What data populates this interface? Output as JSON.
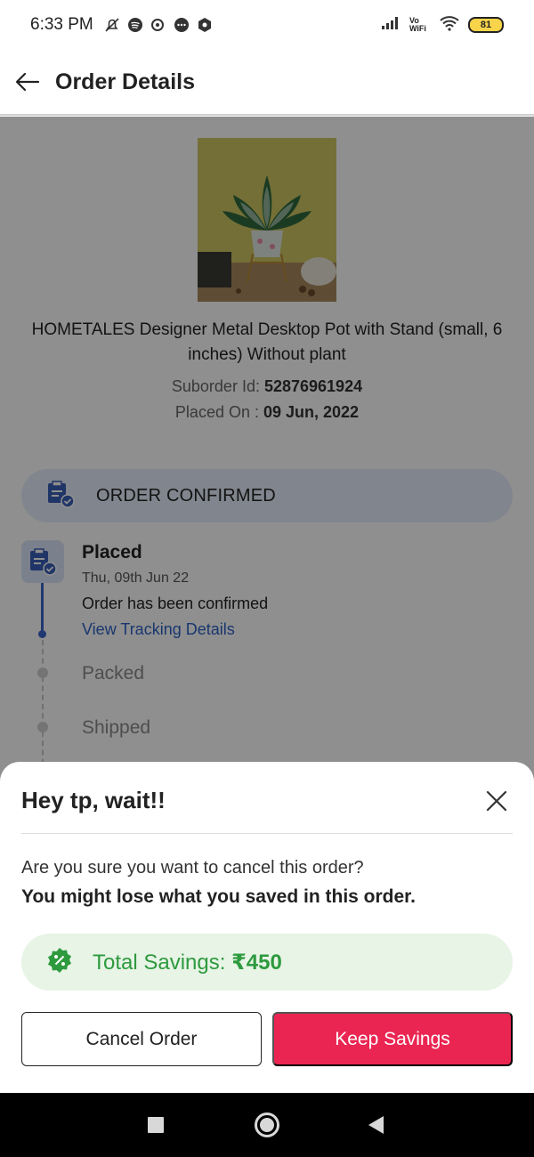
{
  "status_bar": {
    "time": "6:33 PM",
    "battery": "81",
    "network_label": "Vo WiFi"
  },
  "header": {
    "title": "Order Details",
    "back_icon": "arrow-left-icon"
  },
  "product": {
    "title": "HOMETALES Designer Metal Desktop Pot with Stand (small, 6 inches) Without plant",
    "suborder_label": "Suborder Id:",
    "suborder_id": "52876961924",
    "placed_label": "Placed On :",
    "placed_date": "09 Jun, 2022"
  },
  "order_status": {
    "label": "ORDER CONFIRMED",
    "icon": "order-confirmed-icon"
  },
  "timeline": {
    "placed": {
      "title": "Placed",
      "date": "Thu, 09th Jun 22",
      "description": "Order has been confirmed",
      "link": "View Tracking Details"
    },
    "packed": {
      "title": "Packed"
    },
    "shipped": {
      "title": "Shipped"
    }
  },
  "sheet": {
    "title": "Hey tp, wait!!",
    "question": "Are you sure you want to cancel this order?",
    "warning": "You might lose what you saved in this order.",
    "savings_label": "Total Savings:",
    "savings_value": "₹450",
    "cancel_label": "Cancel Order",
    "keep_label": "Keep Savings"
  },
  "colors": {
    "accent": "#ea2552",
    "savings_green": "#2e9a3e",
    "link_blue": "#2d62c5"
  }
}
